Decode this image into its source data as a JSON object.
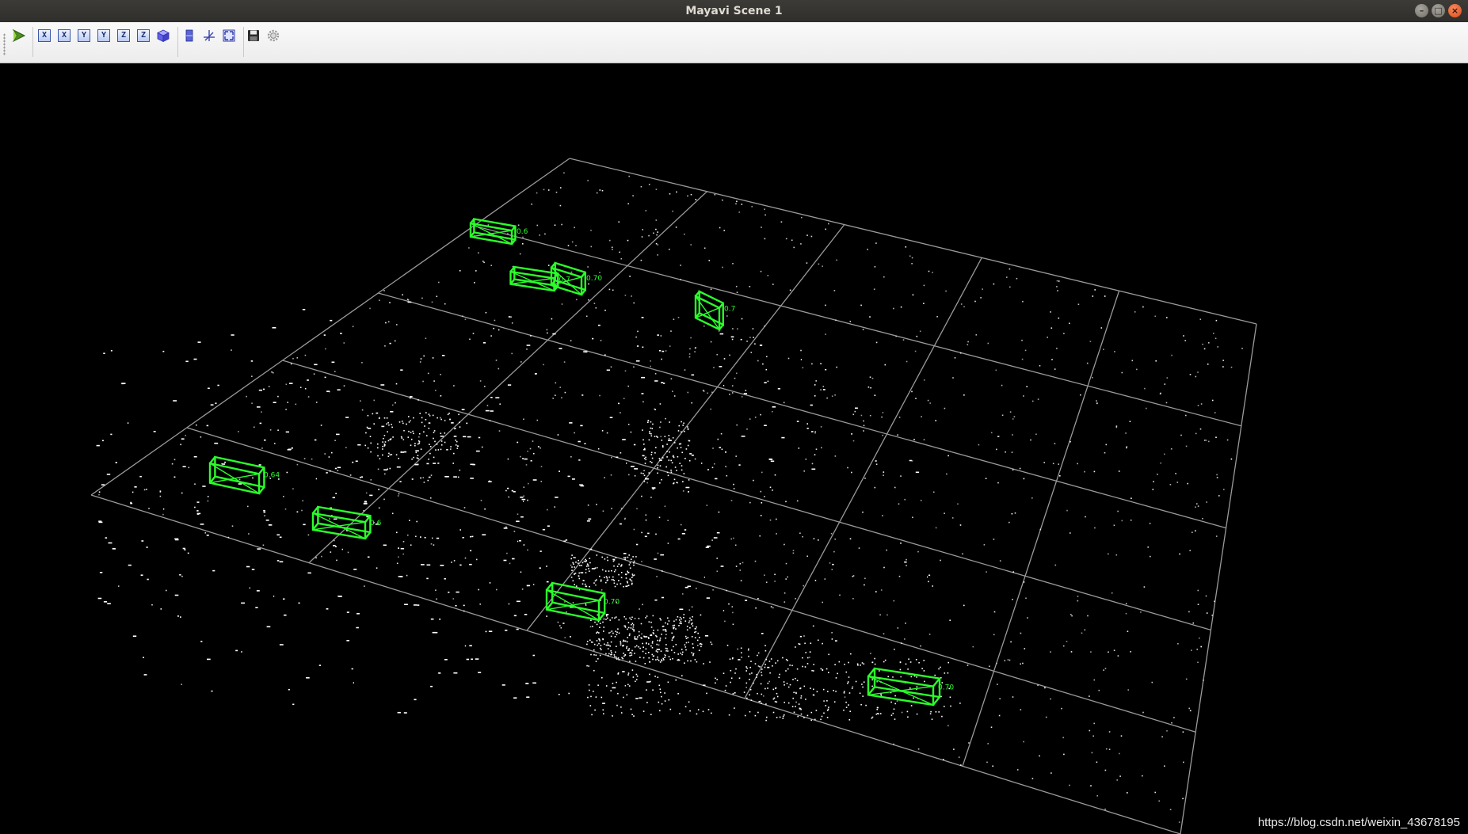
{
  "window": {
    "title": "Mayavi Scene 1"
  },
  "toolbar": {
    "buttons": [
      {
        "id": "interaction",
        "icon": "mayavi-arrow-icon"
      },
      {
        "id": "view-x-pos",
        "label": "X",
        "icon": "axis-x-icon"
      },
      {
        "id": "view-x-neg",
        "label": "X",
        "icon": "axis-x-icon"
      },
      {
        "id": "view-y-pos",
        "label": "Y",
        "icon": "axis-y-icon"
      },
      {
        "id": "view-y-neg",
        "label": "Y",
        "icon": "axis-y-icon"
      },
      {
        "id": "view-z-pos",
        "label": "Z",
        "icon": "axis-z-icon"
      },
      {
        "id": "view-z-neg",
        "label": "Z",
        "icon": "axis-z-icon"
      },
      {
        "id": "isometric",
        "icon": "cube-icon"
      },
      {
        "id": "parallel-projection",
        "icon": "projection-icon"
      },
      {
        "id": "show-axes",
        "icon": "axes-icon"
      },
      {
        "id": "full-screen",
        "icon": "fullscreen-icon"
      },
      {
        "id": "save",
        "icon": "floppy-disk-icon"
      },
      {
        "id": "configure",
        "icon": "gear-icon"
      }
    ]
  },
  "scene": {
    "background": "#000000",
    "grid_color": "#9a9a9a",
    "points_color": "#ffffff",
    "box_color": "#2bff2b",
    "detections": [
      {
        "id": "box-1",
        "score": "0.6"
      },
      {
        "id": "box-2",
        "score": "0.7"
      },
      {
        "id": "box-3",
        "score": "0.70"
      },
      {
        "id": "box-4",
        "score": "0.7"
      },
      {
        "id": "box-5",
        "score": "0.64"
      },
      {
        "id": "box-6",
        "score": "0.6"
      },
      {
        "id": "box-7",
        "score": "0.70"
      },
      {
        "id": "box-8",
        "score": "0.70"
      }
    ]
  },
  "watermark": "https://blog.csdn.net/weixin_43678195"
}
